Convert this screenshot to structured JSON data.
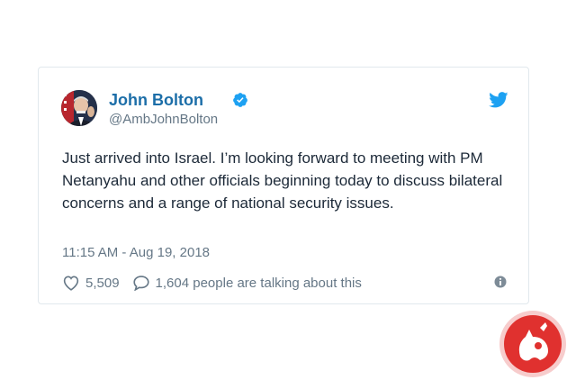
{
  "tweet": {
    "author_name": "John Bolton",
    "handle": "@AmbJohnBolton",
    "text": "Just arrived into Israel. I’m looking forward to meeting with PM Netanyahu and other officials beginning today to discuss bilateral concerns and a range of national security issues.",
    "timestamp": "11:15 AM - Aug 19, 2018",
    "like_count": "5,509",
    "talking_text": "1,604 people are talking about this"
  },
  "icons": {
    "verified": "verified-badge-icon",
    "brand": "twitter-bird-icon",
    "like": "heart-icon",
    "reply": "speech-bubble-icon",
    "info": "info-icon",
    "watermark": "red-circle-logo"
  },
  "colors": {
    "name": "#1c6ea8",
    "twitter_blue": "#1da1f2",
    "text": "#1c2938",
    "muted": "#657786",
    "border": "#e1e8ed",
    "watermark_red": "#e0312f"
  }
}
